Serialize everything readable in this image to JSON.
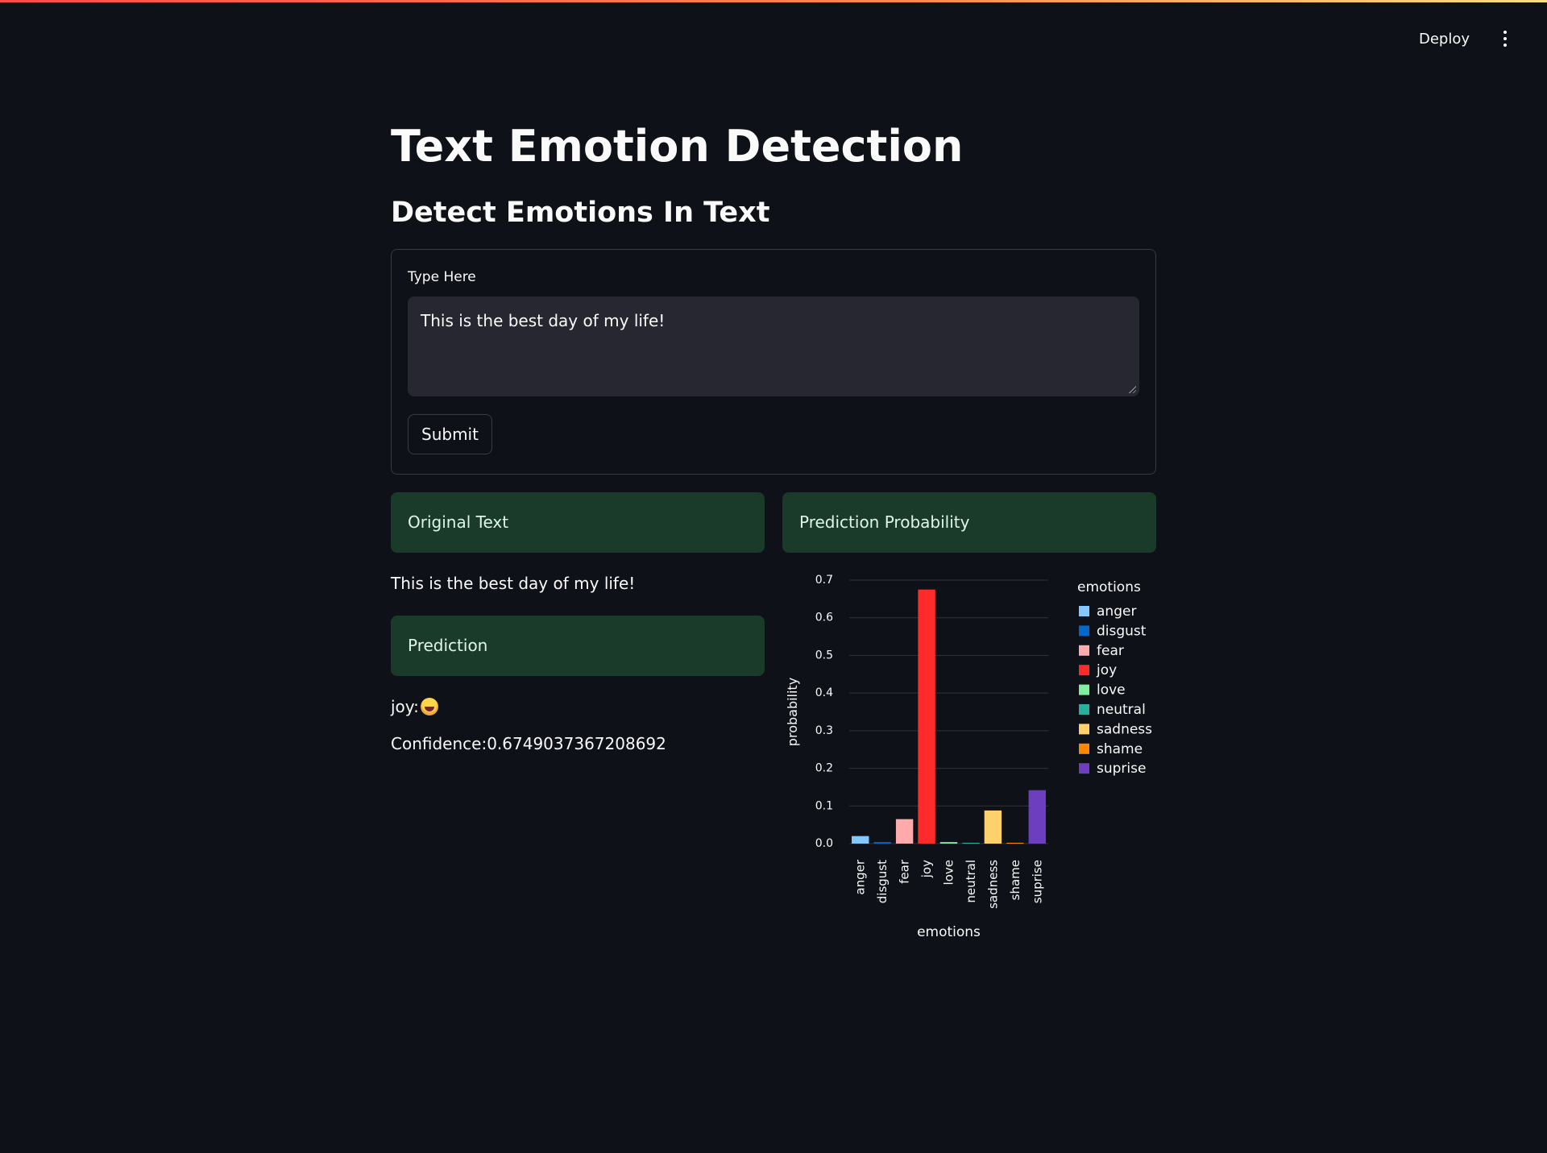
{
  "header": {
    "deploy_label": "Deploy",
    "menu_icon": "kebab-menu-icon"
  },
  "main": {
    "title": "Text Emotion Detection",
    "subtitle": "Detect Emotions In Text",
    "form": {
      "input_label": "Type Here",
      "input_value": "This is the best day of my life!",
      "submit_label": "Submit"
    },
    "left": {
      "original_header": "Original Text",
      "original_text": "This is the best day of my life!",
      "prediction_header": "Prediction",
      "prediction_label": "joy:",
      "prediction_emoji_icon": "laughing-face-icon",
      "confidence_text": "Confidence:0.6749037367208692"
    },
    "right": {
      "probability_header": "Prediction Probability"
    }
  },
  "chart_data": {
    "type": "bar",
    "categories": [
      "anger",
      "disgust",
      "fear",
      "joy",
      "love",
      "neutral",
      "sadness",
      "shame",
      "suprise"
    ],
    "values": [
      0.02,
      0.004,
      0.065,
      0.675,
      0.004,
      0.002,
      0.088,
      0.001,
      0.142
    ],
    "colors": [
      "#83c9ff",
      "#0068c9",
      "#ffabab",
      "#ff2b2b",
      "#7defa1",
      "#29b09d",
      "#ffd16a",
      "#ff8700",
      "#6d3fc0"
    ],
    "xlabel": "emotions",
    "ylabel": "probability",
    "ylim": [
      0,
      0.7
    ],
    "yticks": [
      "0.0",
      "0.1",
      "0.2",
      "0.3",
      "0.4",
      "0.5",
      "0.6",
      "0.7"
    ],
    "legend_title": "emotions",
    "legend_position": "right",
    "grid": true
  }
}
